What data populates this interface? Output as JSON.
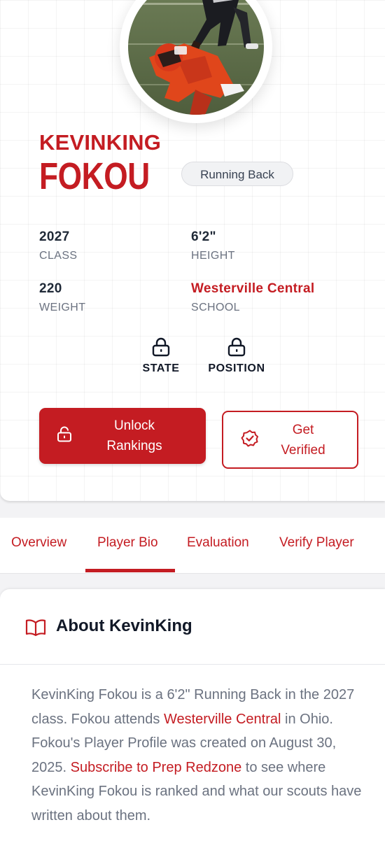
{
  "player": {
    "first_name": "KEVINKING",
    "last_name": "FOKOU",
    "position": "Running Back"
  },
  "stats": [
    {
      "value": "2027",
      "label": "CLASS"
    },
    {
      "value": "6'2\"",
      "label": "HEIGHT"
    },
    {
      "value": "220",
      "label": "WEIGHT"
    },
    {
      "value": "Westerville Central",
      "label": "SCHOOL"
    }
  ],
  "locked_fields": [
    {
      "label": "STATE",
      "icon": "lock-icon"
    },
    {
      "label": "POSITION",
      "icon": "lock-icon"
    }
  ],
  "buttons": {
    "unlock": {
      "line1": "Unlock",
      "line2": "Rankings",
      "icon": "unlock-icon"
    },
    "verify": {
      "line1": "Get",
      "line2": "Verified",
      "icon": "verified-badge-icon"
    }
  },
  "tabs": [
    {
      "label": "Overview"
    },
    {
      "label": "Player Bio",
      "active": true
    },
    {
      "label": "Evaluation"
    },
    {
      "label": "Verify Player"
    }
  ],
  "about": {
    "icon": "book-icon",
    "title": "About KevinKing",
    "p1": "KevinKing Fokou is a 6'2\" Running Back in the 2027 class. Fokou attends ",
    "school_link": "Westerville Central",
    "p2": " in Ohio. Fokou's Player Profile was created on August 30, 2025. ",
    "subscribe_link": "Subscribe to Prep Redzone",
    "p3": " to see where KevinKing Fokou is ranked and what our scouts have written about them."
  },
  "colors": {
    "brand_red": "#c41c22",
    "text_dark": "#111827",
    "text_muted": "#6b7280",
    "background": "#f3f3f5"
  }
}
